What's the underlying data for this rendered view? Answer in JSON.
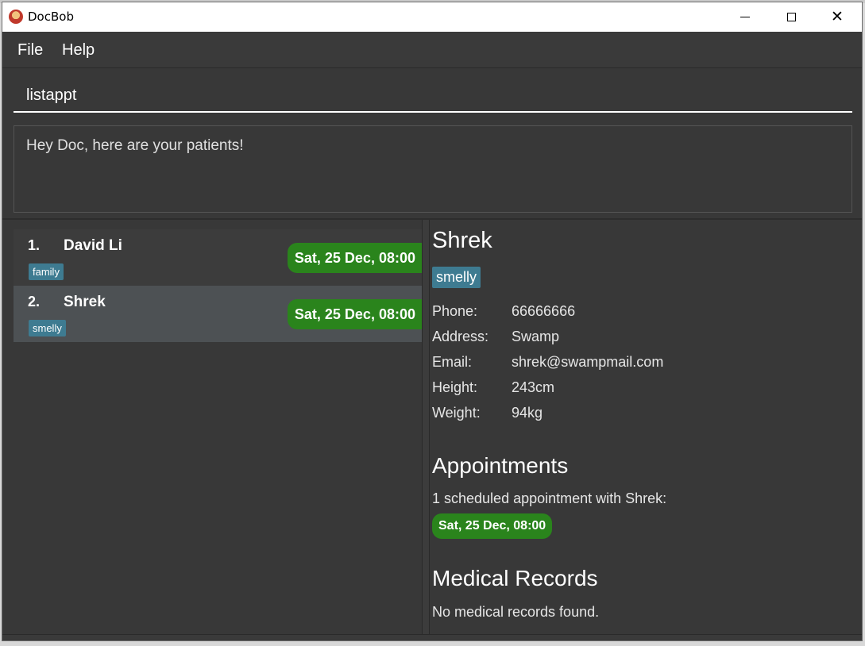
{
  "window": {
    "title": "DocBob"
  },
  "menu": {
    "file": "File",
    "help": "Help"
  },
  "command": {
    "value": "listappt"
  },
  "result": {
    "message": "Hey Doc, here are your patients!"
  },
  "patients": [
    {
      "index": "1.",
      "name": "David Li",
      "tag": "family",
      "appointment": "Sat, 25 Dec, 08:00",
      "selected": false
    },
    {
      "index": "2.",
      "name": "Shrek",
      "tag": "smelly",
      "appointment": "Sat, 25 Dec, 08:00",
      "selected": true
    }
  ],
  "details": {
    "name": "Shrek",
    "tag": "smelly",
    "fields": [
      {
        "label": "Phone:",
        "value": "66666666"
      },
      {
        "label": "Address:",
        "value": "Swamp"
      },
      {
        "label": "Email:",
        "value": "shrek@swampmail.com"
      },
      {
        "label": "Height:",
        "value": "243cm"
      },
      {
        "label": "Weight:",
        "value": "94kg"
      }
    ],
    "appointments_title": "Appointments",
    "appointments_summary": "1 scheduled appointment with Shrek:",
    "appointment": "Sat, 25 Dec, 08:00",
    "records_title": "Medical Records",
    "records_text": "No medical records found."
  },
  "colors": {
    "background": "#383838",
    "tag": "#3e7b91",
    "appointment": "#2a841c",
    "selected_row": "#4d5154"
  },
  "icons": {
    "app": "docbob-app-icon",
    "minimize": "minimize-icon",
    "maximize": "maximize-icon",
    "close": "close-icon"
  }
}
